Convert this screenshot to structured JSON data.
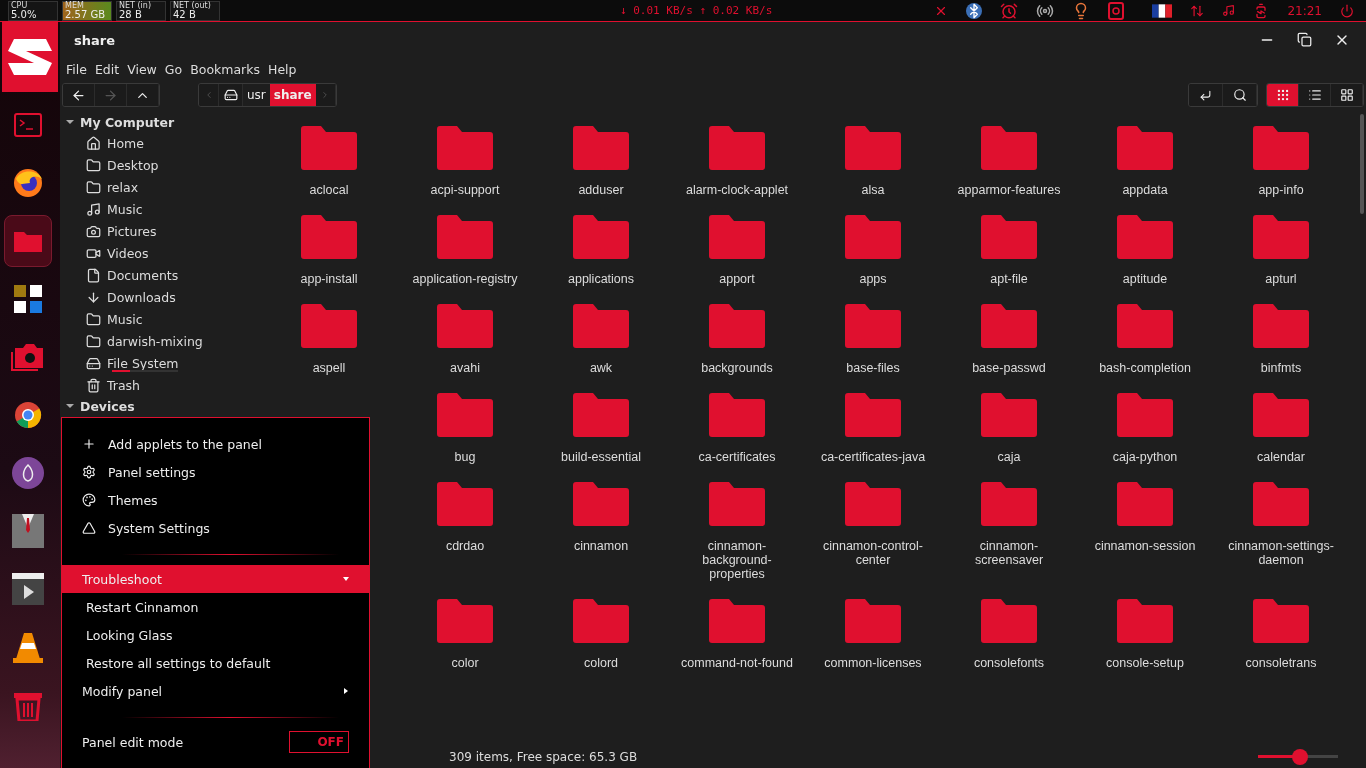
{
  "top_panel": {
    "monitors": [
      {
        "label": "CPU",
        "value": "5.0%",
        "kind": "cpu"
      },
      {
        "label": "MEM",
        "value": "2.57 GB",
        "kind": "mem"
      },
      {
        "label": "NET (in)",
        "value": "28 B",
        "kind": "net"
      },
      {
        "label": "NET (out)",
        "value": "42 B",
        "kind": "net"
      }
    ],
    "net_speed": "↓ 0.01 KB/s ↑ 0.02 KB/s",
    "clock": "21:21"
  },
  "dock": [
    {
      "kind": "logo",
      "active": false
    },
    {
      "kind": "terminal",
      "active": false
    },
    {
      "kind": "firefox",
      "active": false
    },
    {
      "kind": "files",
      "active": true
    },
    {
      "kind": "ob",
      "active": false
    },
    {
      "kind": "camera",
      "active": false
    },
    {
      "kind": "chrome",
      "active": false
    },
    {
      "kind": "tor",
      "active": false
    },
    {
      "kind": "suit",
      "active": false
    },
    {
      "kind": "video",
      "active": false
    },
    {
      "kind": "vlc",
      "active": false
    },
    {
      "kind": "trash",
      "active": false
    }
  ],
  "window": {
    "title": "share"
  },
  "menu_bar": [
    "File",
    "Edit",
    "View",
    "Go",
    "Bookmarks",
    "Help"
  ],
  "path": [
    {
      "label": "usr",
      "selected": false
    },
    {
      "label": "share",
      "selected": true
    }
  ],
  "view_modes": [
    {
      "kind": "icons",
      "selected": true
    },
    {
      "kind": "list",
      "selected": false
    },
    {
      "kind": "compact",
      "selected": false
    }
  ],
  "sidebar": [
    {
      "title": "My Computer",
      "expanded": true,
      "items": [
        {
          "label": "Home",
          "kind": "home"
        },
        {
          "label": "Desktop",
          "kind": "folder"
        },
        {
          "label": "relax",
          "kind": "folder"
        },
        {
          "label": "Music",
          "kind": "music"
        },
        {
          "label": "Pictures",
          "kind": "camera"
        },
        {
          "label": "Videos",
          "kind": "video"
        },
        {
          "label": "Documents",
          "kind": "document"
        },
        {
          "label": "Downloads",
          "kind": "download"
        },
        {
          "label": "Music",
          "kind": "folder"
        },
        {
          "label": "darwish-mixing",
          "kind": "folder"
        },
        {
          "label": "File System",
          "kind": "drive",
          "usage": {
            "level": 0.27
          }
        },
        {
          "label": "Trash",
          "kind": "trash"
        }
      ]
    },
    {
      "title": "Devices",
      "expanded": true
    }
  ],
  "folders": [
    "aclocal",
    "acpi-support",
    "adduser",
    "alarm-clock-applet",
    "alsa",
    "apparmor-features",
    "appdata",
    "app-info",
    "app-install",
    "application-registry",
    "applications",
    "apport",
    "apps",
    "apt-file",
    "aptitude",
    "apturl",
    "aspell",
    "avahi",
    "awk",
    "backgrounds",
    "base-files",
    "base-passwd",
    "bash-completion",
    "binfmts",
    "bug",
    "build-essential",
    "ca-certificates",
    "ca-certificates-java",
    "caja",
    "caja-python",
    "calendar",
    "cdrdao",
    "cinnamon",
    "cinnamon-background-properties",
    "cinnamon-control-center",
    "cinnamon-screensaver",
    "cinnamon-session",
    "cinnamon-settings-daemon",
    "color",
    "colord",
    "command-not-found",
    "common-licenses",
    "consolefonts",
    "console-setup",
    "consoletrans"
  ],
  "status_bar": "309 items, Free space: 65.3 GB",
  "zoom": {
    "level": 0.52
  },
  "context_menu": {
    "items": [
      {
        "kind": "add",
        "label": "Add applets to the panel"
      },
      {
        "kind": "settings",
        "label": "Panel settings"
      },
      {
        "kind": "themes",
        "label": "Themes"
      },
      {
        "kind": "system",
        "label": "System Settings"
      },
      {
        "kind": "separator"
      },
      {
        "kind": "submenu",
        "label": "Troubleshoot",
        "selected": true,
        "expanded": true,
        "children": [
          "Restart Cinnamon",
          "Looking Glass",
          "Restore all settings to default"
        ]
      },
      {
        "kind": "submenu",
        "label": "Modify panel",
        "selected": false,
        "expanded": false
      },
      {
        "kind": "separator"
      },
      {
        "kind": "toggle",
        "label": "Panel edit mode",
        "on": false,
        "state_text": "OFF"
      }
    ]
  }
}
